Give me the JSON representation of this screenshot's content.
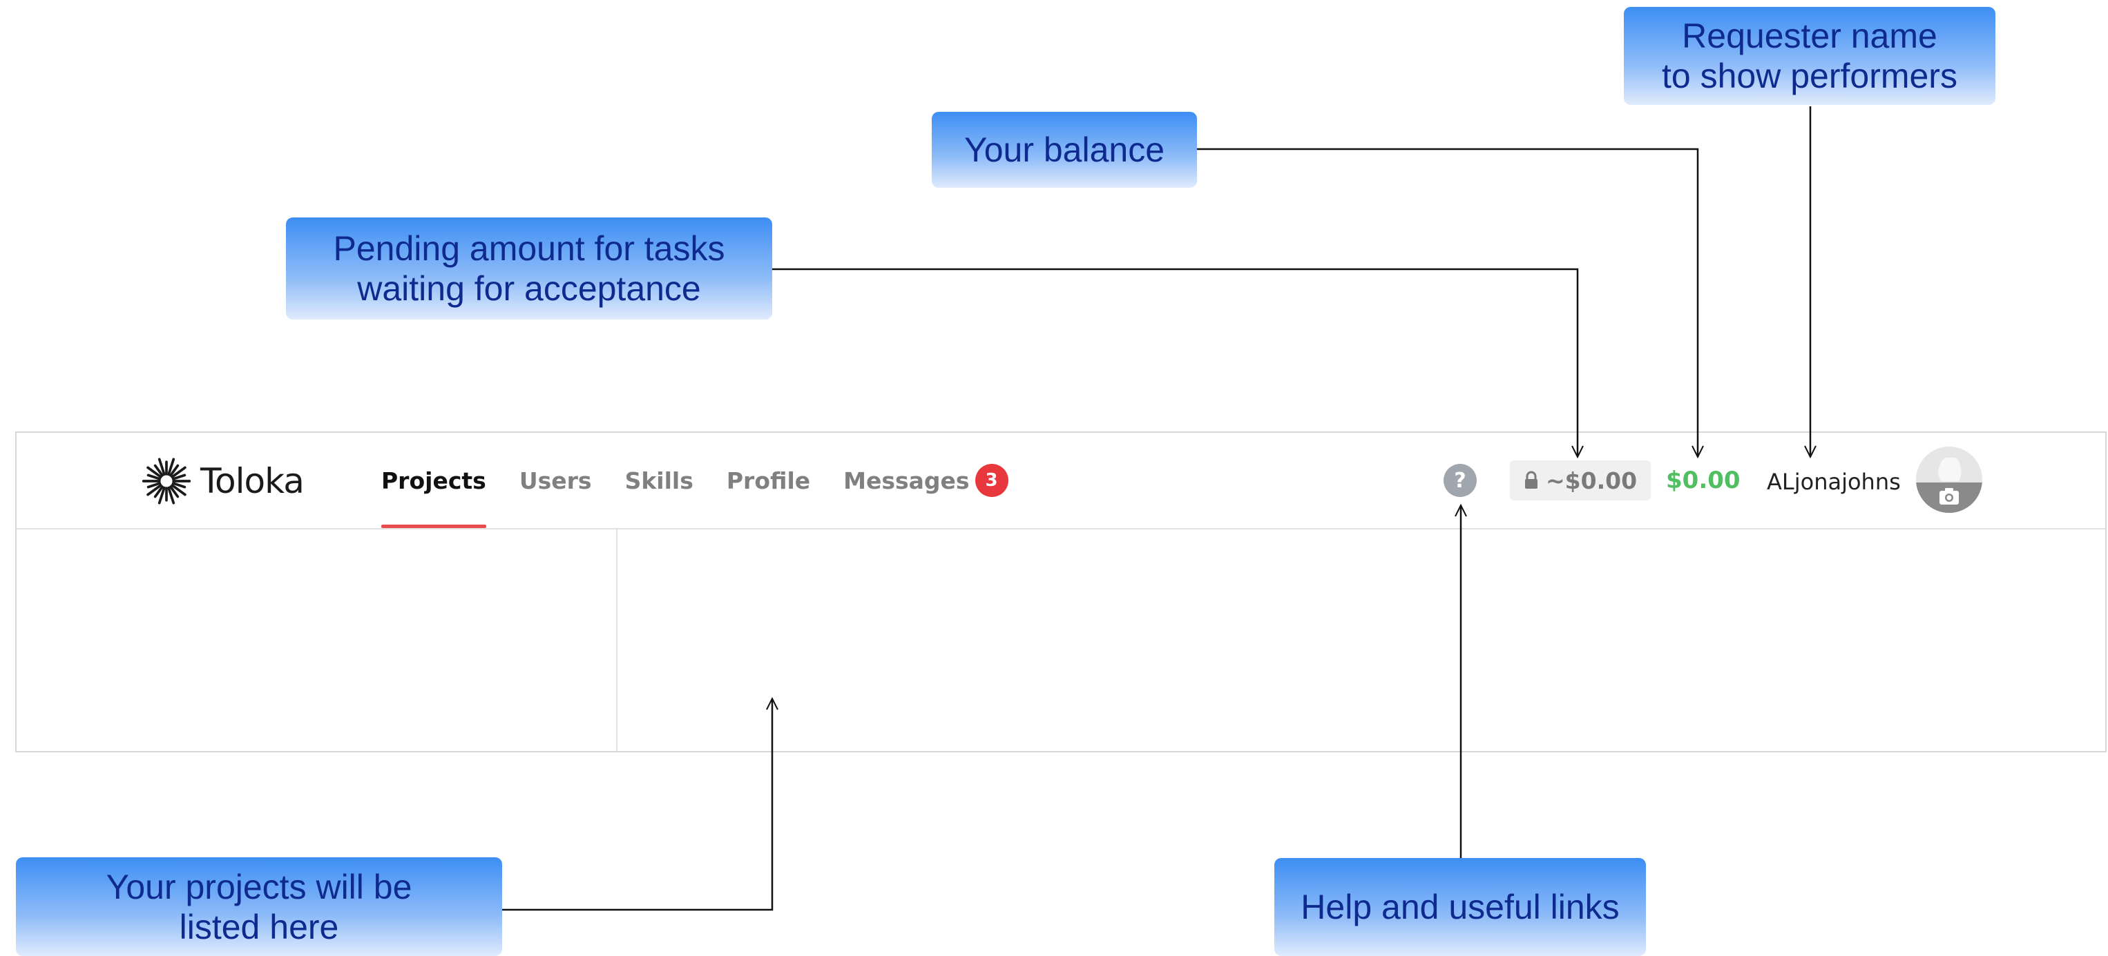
{
  "header": {
    "logo_text": "Toloka",
    "nav": [
      {
        "label": "Projects",
        "active": true
      },
      {
        "label": "Users",
        "active": false
      },
      {
        "label": "Skills",
        "active": false
      },
      {
        "label": "Profile",
        "active": false
      },
      {
        "label": "Messages",
        "active": false,
        "badge": "3"
      }
    ],
    "help_label": "?",
    "pending_amount": "~$0.00",
    "balance": "$0.00",
    "username": "ALjonajohns"
  },
  "callouts": {
    "requester_name": "Requester name\nto show performers",
    "your_balance": "Your balance",
    "pending_amount": "Pending amount for tasks\nwaiting for acceptance",
    "projects_listed": "Your projects will be\nlisted here",
    "help_links": "Help and useful links"
  },
  "colors": {
    "accent_red": "#e84c4c",
    "balance_green": "#4fbf60",
    "callout_blue": "#3d8ef4",
    "callout_text": "#0e2a8f"
  },
  "icons": [
    "toloka-logo-icon",
    "lock-icon",
    "help-icon",
    "camera-icon"
  ]
}
